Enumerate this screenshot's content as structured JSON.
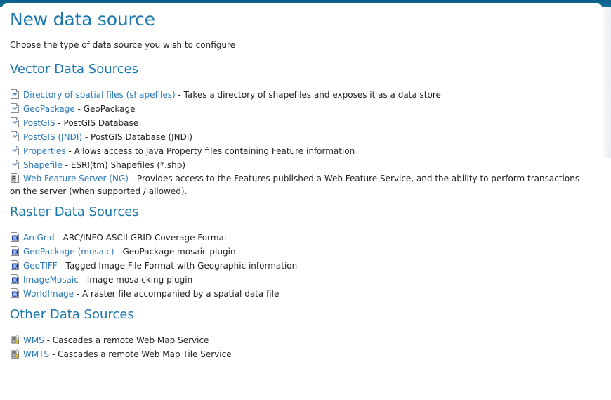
{
  "page": {
    "title": "New data source",
    "subtitle": "Choose the type of data source you wish to configure"
  },
  "vector": {
    "heading": "Vector Data Sources",
    "items": [
      {
        "name": "Directory of spatial files (shapefiles)",
        "desc": " - Takes a directory of shapefiles and exposes it as a data store",
        "icon": "vector-store-icon"
      },
      {
        "name": "GeoPackage",
        "desc": " - GeoPackage",
        "icon": "vector-store-icon"
      },
      {
        "name": "PostGIS",
        "desc": " - PostGIS Database",
        "icon": "vector-store-icon"
      },
      {
        "name": "PostGIS (JNDI)",
        "desc": " - PostGIS Database (JNDI)",
        "icon": "vector-store-icon"
      },
      {
        "name": "Properties",
        "desc": " - Allows access to Java Property files containing Feature information",
        "icon": "vector-store-icon"
      },
      {
        "name": "Shapefile",
        "desc": " - ESRI(tm) Shapefiles (*.shp)",
        "icon": "vector-store-icon"
      },
      {
        "name": "Web Feature Server (NG)",
        "desc": " - Provides access to the Features published a Web Feature Service, and the ability to perform transactions on the server (when supported / allowed).",
        "icon": "wfs-server-icon"
      }
    ]
  },
  "raster": {
    "heading": "Raster Data Sources",
    "items": [
      {
        "name": "ArcGrid",
        "desc": " - ARC/INFO ASCII GRID Coverage Format",
        "icon": "raster-store-icon"
      },
      {
        "name": "GeoPackage (mosaic)",
        "desc": " - GeoPackage mosaic plugin",
        "icon": "raster-store-icon"
      },
      {
        "name": "GeoTIFF",
        "desc": " - Tagged Image File Format with Geographic information",
        "icon": "raster-store-icon"
      },
      {
        "name": "ImageMosaic",
        "desc": " - Image mosaicking plugin",
        "icon": "raster-store-icon"
      },
      {
        "name": "WorldImage",
        "desc": " - A raster file accompanied by a spatial data file",
        "icon": "raster-store-icon"
      }
    ]
  },
  "other": {
    "heading": "Other Data Sources",
    "items": [
      {
        "name": "WMS",
        "desc": " - Cascades a remote Web Map Service",
        "icon": "wms-server-icon"
      },
      {
        "name": "WMTS",
        "desc": " - Cascades a remote Web Map Tile Service",
        "icon": "wms-server-icon"
      }
    ]
  },
  "colors": {
    "heading": "#1b78ad",
    "link": "#2a78b4",
    "topbar": "#0f6f9b"
  }
}
